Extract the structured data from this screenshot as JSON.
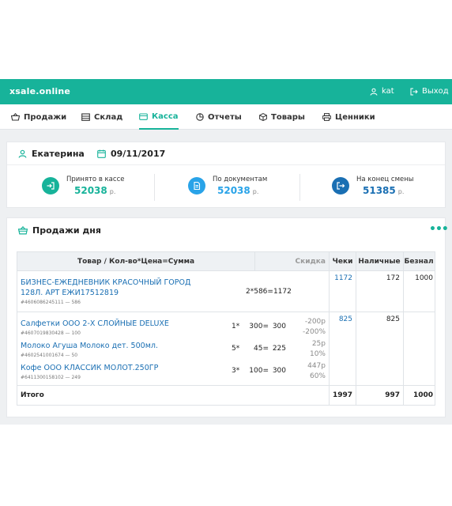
{
  "app": {
    "brand": "xsale.online",
    "user": "kat",
    "exit_label": "Выход"
  },
  "nav": [
    {
      "label": "Продажи",
      "icon": "basket-icon"
    },
    {
      "label": "Склад",
      "icon": "warehouse-icon"
    },
    {
      "label": "Касса",
      "icon": "cashbox-icon",
      "active": true
    },
    {
      "label": "Отчеты",
      "icon": "pie-chart-icon"
    },
    {
      "label": "Товары",
      "icon": "box-icon"
    },
    {
      "label": "Ценники",
      "icon": "printer-icon"
    }
  ],
  "shift": {
    "cashier": "Екатерина",
    "date": "09/11/2017",
    "stats": [
      {
        "label": "Принято в кассе",
        "value": "52038",
        "currency": "р.",
        "icon": "cash-in-icon",
        "color": "#17b39a"
      },
      {
        "label": "По документам",
        "value": "52038",
        "currency": "р.",
        "icon": "document-icon",
        "color": "#29a3e8"
      },
      {
        "label": "На конец смены",
        "value": "51385",
        "currency": "р.",
        "icon": "cash-out-icon",
        "color": "#1a6fb3"
      }
    ]
  },
  "sales": {
    "title": "Продажи дня",
    "more_label": "•••",
    "columns": {
      "item": "Товар / Кол-во*Цена=Сумма",
      "discount": "Скидка",
      "receipt": "Чеки",
      "cash": "Наличные",
      "card": "Безнал"
    },
    "receipts": [
      {
        "receipt_no": "1172",
        "cash": "172",
        "card": "1000",
        "items": [
          {
            "name_line1": "БИЗНЕС-ЕЖЕДНЕВНИК КРАСОЧНЫЙ ГОРОД",
            "name_line2": "128Л. АРТ ЕЖИ17512819",
            "sku": "#4606086245111 — 586",
            "calc": "2*586=1172"
          }
        ]
      },
      {
        "receipt_no": "825",
        "cash": "825",
        "card": "",
        "items": [
          {
            "name": "Салфетки ООО 2-Х СЛОЙНЫЕ DELUXE",
            "sku": "#4607019830428 — 100",
            "qty": "1*",
            "price": "300=",
            "sum": "300",
            "disc1": "-200р",
            "disc2": "-200%"
          },
          {
            "name": "Молоко Агуша Молоко дет. 500мл.",
            "sku": "#4602541001674 — 50",
            "qty": "5*",
            "price": "45=",
            "sum": "225",
            "disc1": "25р",
            "disc2": "10%"
          },
          {
            "name": "Кофе ООО КЛАССИК МОЛОТ.250ГР",
            "sku": "#6411300158102 — 249",
            "qty": "3*",
            "price": "100=",
            "sum": "300",
            "disc1": "447р",
            "disc2": "60%"
          }
        ]
      }
    ],
    "total": {
      "label": "Итого",
      "receipt": "1997",
      "cash": "997",
      "card": "1000"
    }
  }
}
